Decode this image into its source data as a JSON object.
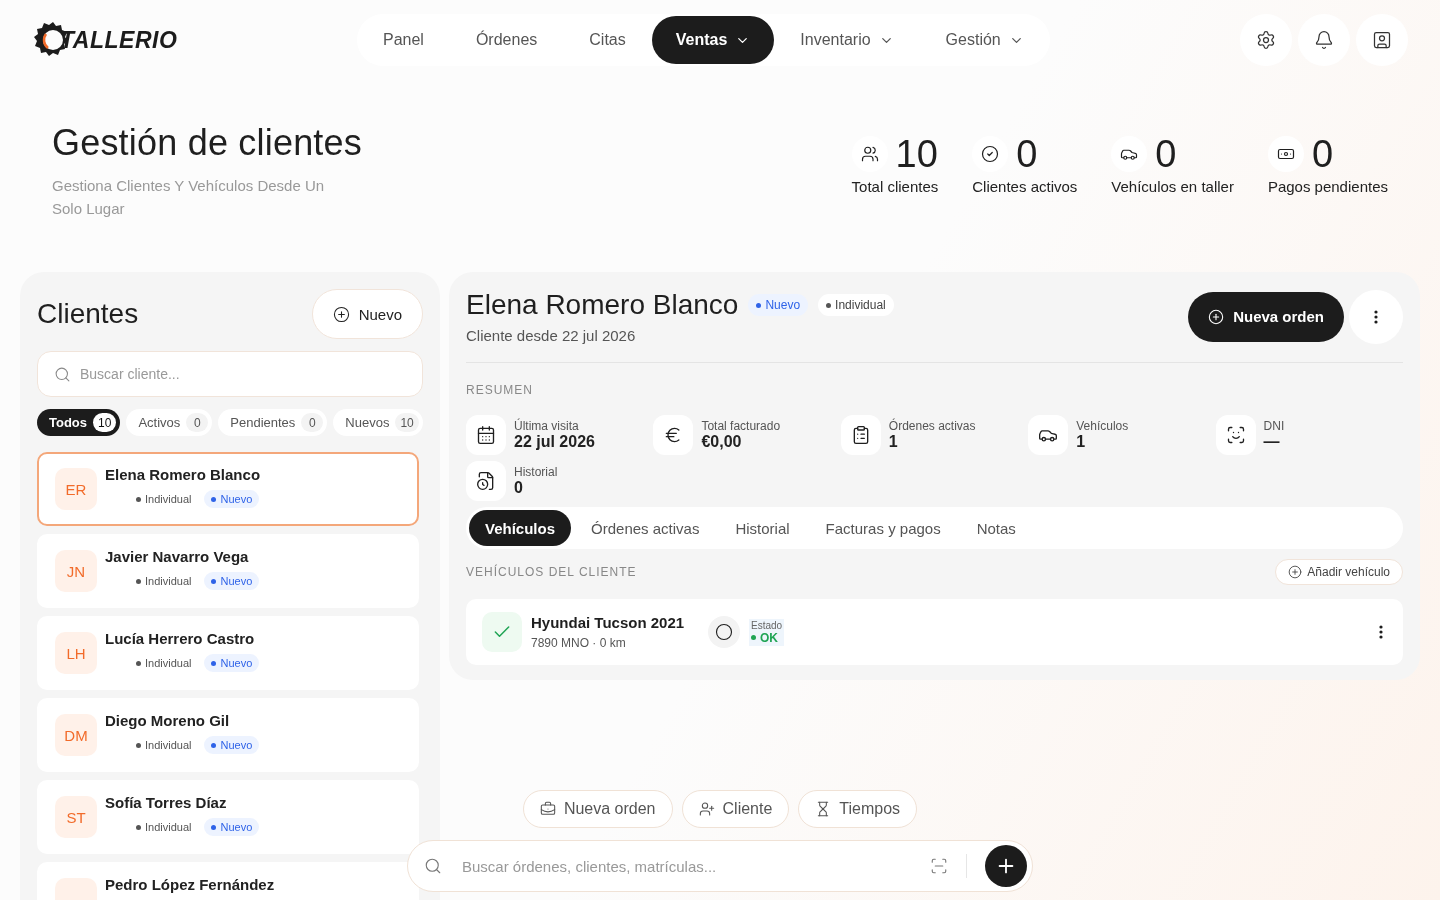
{
  "brand": {
    "name": "TALLERIO"
  },
  "nav": [
    {
      "label": "Panel",
      "selected": false,
      "dropdown": false
    },
    {
      "label": "Órdenes",
      "selected": false,
      "dropdown": false
    },
    {
      "label": "Citas",
      "selected": false,
      "dropdown": false
    },
    {
      "label": "Ventas",
      "selected": true,
      "dropdown": true
    },
    {
      "label": "Inventario",
      "selected": false,
      "dropdown": true
    },
    {
      "label": "Gestión",
      "selected": false,
      "dropdown": true
    }
  ],
  "page": {
    "title": "Gestión de clientes",
    "subtitle": "Gestiona Clientes Y Vehículos Desde Un Solo Lugar"
  },
  "stats": [
    {
      "kind": "clients",
      "value": "10",
      "label": "Total clientes"
    },
    {
      "kind": "active",
      "value": "0",
      "label": "Clientes activos"
    },
    {
      "kind": "vehicles",
      "value": "0",
      "label": "Vehículos en taller"
    },
    {
      "kind": "payments",
      "value": "0",
      "label": "Pagos pendientes"
    }
  ],
  "clients_panel": {
    "title": "Clientes",
    "new_button": "Nuevo",
    "search": {
      "placeholder": "Buscar cliente..."
    },
    "filters": [
      {
        "label": "Todos",
        "count": "10",
        "selected": true
      },
      {
        "label": "Activos",
        "count": "0",
        "selected": false
      },
      {
        "label": "Pendientes",
        "count": "0",
        "selected": false
      },
      {
        "label": "Nuevos",
        "count": "10",
        "selected": false
      }
    ],
    "clients": [
      {
        "initials": "ER",
        "name": "Elena Romero Blanco",
        "selected": true,
        "tags": [
          {
            "kind": "type",
            "label": "Individual"
          },
          {
            "kind": "status",
            "label": "Nuevo"
          }
        ]
      },
      {
        "initials": "JN",
        "name": "Javier Navarro Vega",
        "selected": false,
        "tags": [
          {
            "kind": "type",
            "label": "Individual"
          },
          {
            "kind": "status",
            "label": "Nuevo"
          }
        ]
      },
      {
        "initials": "LH",
        "name": "Lucía Herrero Castro",
        "selected": false,
        "tags": [
          {
            "kind": "type",
            "label": "Individual"
          },
          {
            "kind": "status",
            "label": "Nuevo"
          }
        ]
      },
      {
        "initials": "DM",
        "name": "Diego Moreno Gil",
        "selected": false,
        "tags": [
          {
            "kind": "type",
            "label": "Individual"
          },
          {
            "kind": "status",
            "label": "Nuevo"
          }
        ]
      },
      {
        "initials": "ST",
        "name": "Sofía Torres Díaz",
        "selected": false,
        "tags": [
          {
            "kind": "type",
            "label": "Individual"
          },
          {
            "kind": "status",
            "label": "Nuevo"
          }
        ]
      },
      {
        "name": "Pedro López Fernández",
        "selected": false
      }
    ]
  },
  "detail": {
    "name": "Elena Romero Blanco",
    "tags": [
      {
        "kind": "status",
        "label": "Nuevo"
      },
      {
        "kind": "type",
        "label": "Individual"
      }
    ],
    "since": "Cliente desde 22 jul 2026",
    "primary_button": "Nueva orden",
    "summary_title": "RESUMEN",
    "summary": [
      {
        "kind": "last_visit",
        "label": "Última visita",
        "value": "22 jul 2026"
      },
      {
        "kind": "billed",
        "label": "Total facturado",
        "value": "€0,00"
      },
      {
        "kind": "orders",
        "label": "Órdenes activas",
        "value": "1"
      },
      {
        "kind": "vehicles",
        "label": "Vehículos",
        "value": "1"
      },
      {
        "kind": "id",
        "label": "DNI",
        "value": "—"
      },
      {
        "kind": "history",
        "label": "Historial",
        "value": "0"
      }
    ],
    "tabs": [
      {
        "label": "Vehículos",
        "selected": true
      },
      {
        "label": "Órdenes activas",
        "selected": false
      },
      {
        "label": "Historial",
        "selected": false
      },
      {
        "label": "Facturas y pagos",
        "selected": false
      },
      {
        "label": "Notas",
        "selected": false
      }
    ],
    "section_title": "VEHÍCULOS DEL CLIENTE",
    "add_button": "Añadir vehículo",
    "vehicles": [
      {
        "name": "Hyundai Tucson 2021",
        "meta": "7890 MNO · 0 km",
        "status_label": "Estado",
        "status": {
          "kind": "ok",
          "label": "OK"
        }
      }
    ]
  },
  "quick_actions": [
    {
      "kind": "order",
      "label": "Nueva orden"
    },
    {
      "kind": "client",
      "label": "Cliente"
    },
    {
      "kind": "time",
      "label": "Tiempos"
    }
  ],
  "command_bar": {
    "placeholder": "Buscar órdenes, clientes, matrículas..."
  }
}
